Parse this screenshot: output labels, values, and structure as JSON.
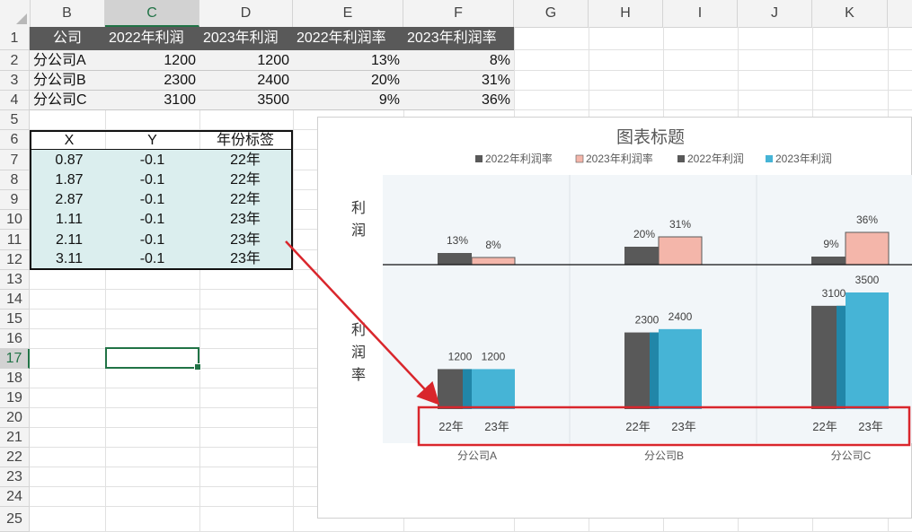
{
  "sheet": {
    "columns": [
      "B",
      "C",
      "D",
      "E",
      "F",
      "G",
      "H",
      "I",
      "J",
      "K"
    ],
    "active_column": "C",
    "rows": [
      "1",
      "2",
      "3",
      "4",
      "5",
      "6",
      "7",
      "8",
      "9",
      "10",
      "11",
      "12",
      "13",
      "14",
      "15",
      "16",
      "17",
      "18",
      "19",
      "20",
      "21",
      "22",
      "23",
      "24",
      "25"
    ],
    "active_row": "17"
  },
  "table1": {
    "headers": [
      "公司",
      "2022年利润",
      "2023年利润",
      "2022年利润率",
      "2023年利润率"
    ],
    "rows": [
      [
        "分公司A",
        "1200",
        "1200",
        "13%",
        "8%"
      ],
      [
        "分公司B",
        "2300",
        "2400",
        "20%",
        "31%"
      ],
      [
        "分公司C",
        "3100",
        "3500",
        "9%",
        "36%"
      ]
    ]
  },
  "table2": {
    "headers": [
      "X",
      "Y",
      "年份标签"
    ],
    "rows": [
      [
        "0.87",
        "-0.1",
        "22年"
      ],
      [
        "1.87",
        "-0.1",
        "22年"
      ],
      [
        "2.87",
        "-0.1",
        "22年"
      ],
      [
        "1.11",
        "-0.1",
        "23年"
      ],
      [
        "2.11",
        "-0.1",
        "23年"
      ],
      [
        "3.11",
        "-0.1",
        "23年"
      ]
    ]
  },
  "colors": {
    "dark_bar": "#595959",
    "pink_bar": "#f4b6aa",
    "blue_bar": "#46b4d6",
    "highlight_box": "#d9262c",
    "excel_green": "#217346"
  },
  "chart_data": {
    "type": "bar",
    "title": "图表标题",
    "legend": [
      "2022年利润率",
      "2023年利润率",
      "2022年利润",
      "2023年利润"
    ],
    "legend_position": "top",
    "categories": [
      "分公司A",
      "分公司B",
      "分公司C"
    ],
    "upper_axis_label": "利润",
    "lower_axis_label": "利润率",
    "year_labels": [
      "22年",
      "23年"
    ],
    "series": [
      {
        "name": "2022年利润率",
        "values": [
          13,
          20,
          9
        ],
        "labels": [
          "13%",
          "20%",
          "9%"
        ],
        "color": "#595959"
      },
      {
        "name": "2023年利润率",
        "values": [
          8,
          31,
          36
        ],
        "labels": [
          "8%",
          "31%",
          "36%"
        ],
        "color": "#f4b6aa"
      },
      {
        "name": "2022年利润",
        "values": [
          1200,
          2300,
          3100
        ],
        "labels": [
          "1200",
          "2300",
          "3100"
        ],
        "color": "#595959"
      },
      {
        "name": "2023年利润",
        "values": [
          1200,
          2400,
          3500
        ],
        "labels": [
          "1200",
          "2400",
          "3500"
        ],
        "color": "#46b4d6"
      }
    ]
  }
}
